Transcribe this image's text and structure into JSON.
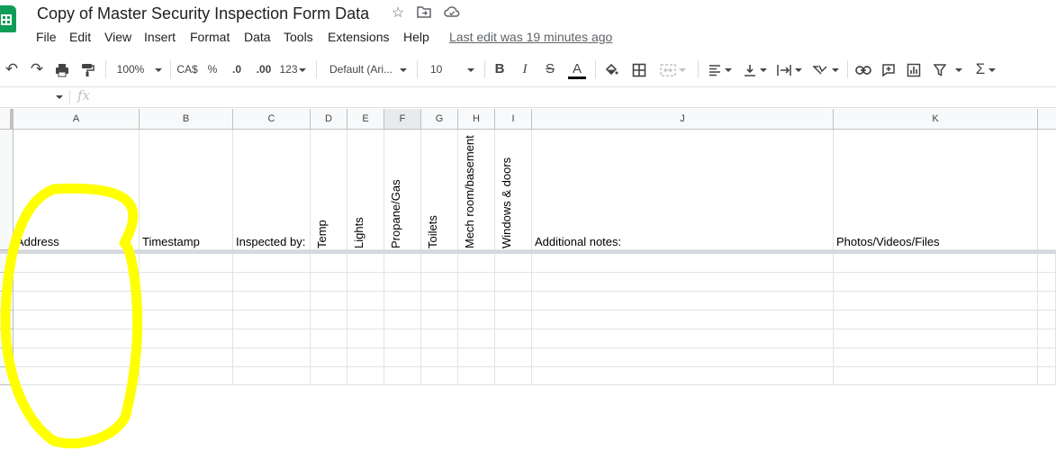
{
  "app": {
    "title": "Copy of Master Security Inspection Form Data",
    "title_icons": [
      "star-icon",
      "move-folder-icon",
      "cloud-saved-icon"
    ]
  },
  "menu": {
    "items": [
      "File",
      "Edit",
      "View",
      "Insert",
      "Format",
      "Data",
      "Tools",
      "Extensions",
      "Help"
    ],
    "last_edit": "Last edit was 19 minutes ago"
  },
  "toolbar": {
    "zoom": "100%",
    "currency": "CA$",
    "percent": "%",
    "decrease_decimal": ".0",
    "increase_decimal": ".00",
    "more_formats": "123",
    "font": "Default (Ari...",
    "font_size": "10",
    "bold": "B",
    "italic": "I",
    "strike": "S",
    "text_color": "A",
    "sum": "Σ"
  },
  "formula_bar": {
    "fx": "fx",
    "value": ""
  },
  "grid": {
    "columns": [
      "A",
      "B",
      "C",
      "D",
      "E",
      "F",
      "G",
      "H",
      "I",
      "J",
      "K"
    ],
    "selected_column": "F",
    "headers": {
      "A": "Address",
      "B": "Timestamp",
      "C": "Inspected by:",
      "D": "Temp",
      "E": "Lights",
      "F": "Propane/Gas",
      "G": "Toilets",
      "H": "Mech room/basement",
      "I": "Windows & doors",
      "J": "Additional notes:",
      "K": "Photos/Videos/Files"
    }
  },
  "annotation": {
    "color": "#ffff00"
  }
}
